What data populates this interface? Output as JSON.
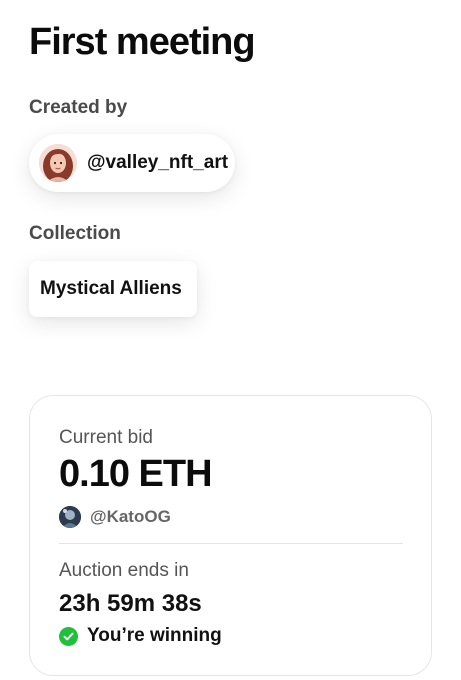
{
  "artwork": {
    "title": "First meeting"
  },
  "creator": {
    "label": "Created by",
    "handle": "@valley_nft_art",
    "avatar_icon": "creator-avatar"
  },
  "collection": {
    "label": "Collection",
    "name": "Mystical Alliens"
  },
  "auction": {
    "current_bid_label": "Current bid",
    "current_bid": "0.10 ETH",
    "top_bidder": "@KatoOG",
    "ends_label": "Auction ends in",
    "time_remaining": "23h 59m 38s",
    "status_text": "You’re winning",
    "status_color": "#1ec13a"
  }
}
